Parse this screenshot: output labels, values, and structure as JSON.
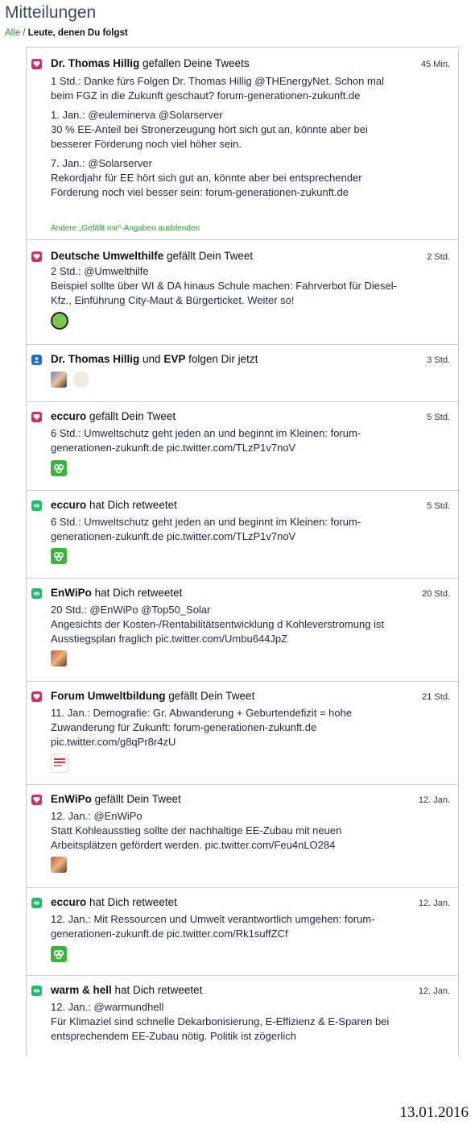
{
  "header": {
    "title": "Mitteilungen",
    "filter_all": "Alle",
    "filter_separator": "/",
    "filter_following": "Leute, denen Du folgst"
  },
  "items": [
    {
      "type": "like",
      "actor": "Dr. Thomas Hillig",
      "action": " gefallen Deine Tweets",
      "time": "45 Min.",
      "paragraphs": [
        "1 Std.: Danke fürs Folgen Dr. Thomas Hillig @THEnergyNet. Schon mal beim FGZ in die Zukunft geschaut? forum-generationen-zukunft.de",
        "1. Jan.: @euleminerva @Solarserver\n30 % EE-Anteil bei Stronerzeugung hört sich gut an, könnte aber bei besserer Förderung noch viel höher sein.",
        "7. Jan.: @Solarserver\nRekordjahr für EE hört sich gut an, könnte aber bei entsprechender Förderung noch viel besser sein: forum-generationen-zukunft.de"
      ],
      "hide_link": "Andere „Gefällt mir“-Angaben ausblenden"
    },
    {
      "type": "like",
      "actor": "Deutsche Umwelthilfe",
      "action": " gefällt Dein Tweet",
      "time": "2 Std.",
      "paragraphs": [
        "2 Std.: @Umwelthilfe\nBeispiel sollte über WI & DA hinaus Schule machen: Fahrverbot für Diesel-Kfz., Einführung City-Maut & Bürgerticket. Weiter so!"
      ]
    },
    {
      "type": "follow",
      "actor": "Dr. Thomas Hillig",
      "action_mid": " und ",
      "actor2": "EVP",
      "action": " folgen Dir jetzt",
      "time": "3 Std."
    },
    {
      "type": "like",
      "actor": "eccuro",
      "action": " gefällt Dein Tweet",
      "time": "5 Std.",
      "paragraphs": [
        "6 Std.: Umweltschutz geht jeden an und beginnt im Kleinen: forum-generationen-zukunft.de pic.twitter.com/TLzP1v7noV"
      ]
    },
    {
      "type": "rt",
      "actor": "eccuro",
      "action": " hat Dich retweetet",
      "time": "5 Std.",
      "paragraphs": [
        "6 Std.: Umweltschutz geht jeden an und beginnt im Kleinen: forum-generationen-zukunft.de pic.twitter.com/TLzP1v7noV"
      ]
    },
    {
      "type": "rt",
      "actor": "EnWiPo",
      "action": " hat Dich retweetet",
      "time": "20 Std.",
      "paragraphs": [
        "20 Std.: @EnWiPo @Top50_Solar\nAngesichts der Kosten-/Rentabilitätsentwicklung d Kohleverstromung ist Ausstiegsplan fraglich pic.twitter.com/Umbu644JpZ"
      ]
    },
    {
      "type": "like",
      "actor": "Forum Umweltbildung",
      "action": " gefällt Dein Tweet",
      "time": "21 Std.",
      "paragraphs": [
        "11. Jan.: Demografie: Gr. Abwanderung + Geburtendefizit = hohe Zuwanderung für Zukunft: forum-generationen-zukunft.de pic.twitter.com/g8qPr8r4zU"
      ]
    },
    {
      "type": "like",
      "actor": "EnWiPo",
      "action": " gefällt Dein Tweet",
      "time": "12. Jan.",
      "paragraphs": [
        "12. Jan.: @EnWiPo\nStatt Kohleausstieg sollte der nachhaltige EE-Zubau mit neuen Arbeitsplätzen gefördert werden. pic.twitter.com/Feu4nLO284"
      ]
    },
    {
      "type": "rt",
      "actor": "eccuro",
      "action": " hat Dich retweetet",
      "time": "12. Jan.",
      "paragraphs": [
        "12. Jan.: Mit Ressourcen und Umwelt verantwortlich umgehen: forum-generationen-zukunft.de pic.twitter.com/Rk1suffZCf"
      ]
    },
    {
      "type": "rt",
      "actor": "warm & hell",
      "action": " hat Dich retweetet",
      "time": "12. Jan.",
      "paragraphs": [
        "12. Jan.: @warmundhell\nFür Klimaziel  sind schnelle Dekarbonisierung, E-Effizienz & E-Sparen bei entsprechendem EE-Zubau nötig. Politik ist zögerlich"
      ]
    }
  ],
  "stamp_date": "13.01.2016",
  "colors": {
    "like": "#e0245e",
    "follow": "#1b6fd1",
    "retweet": "#19bf64",
    "link_green": "#2a9a2a"
  }
}
